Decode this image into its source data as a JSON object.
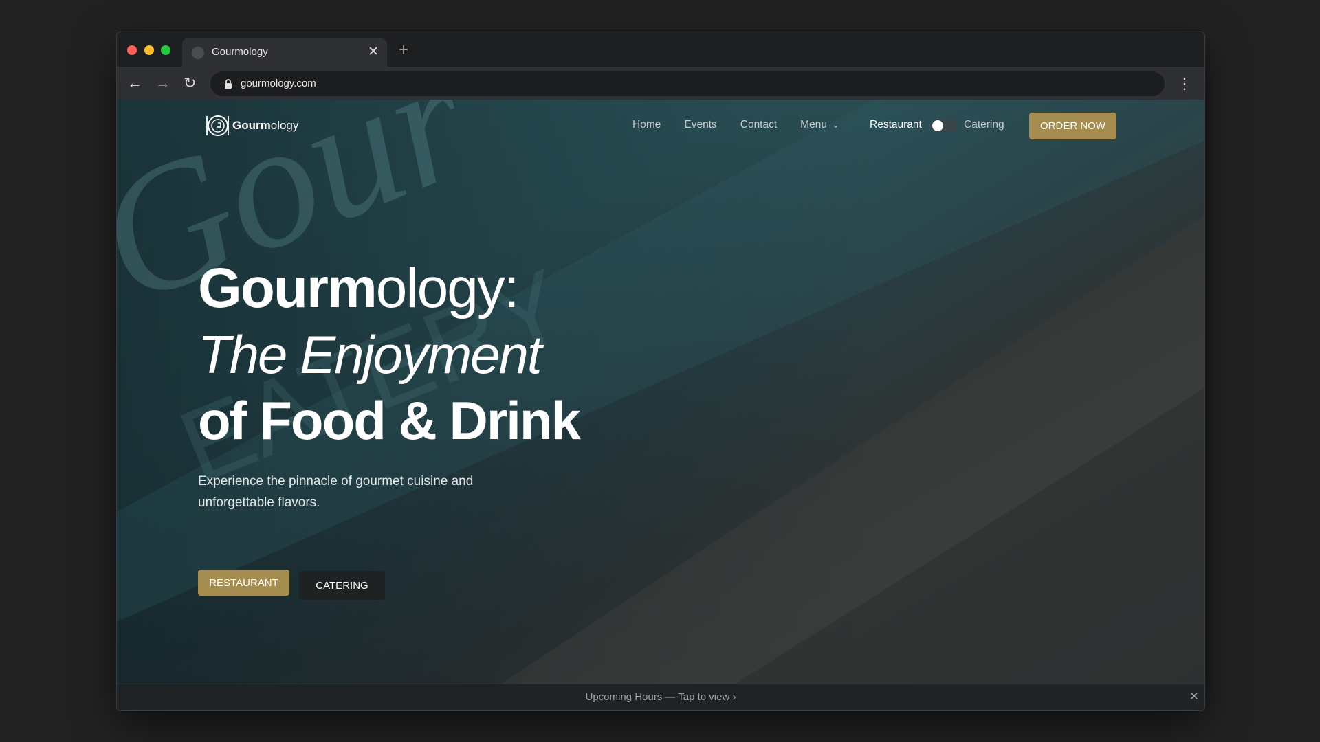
{
  "browser": {
    "tab_title": "Gourmology",
    "tab_close": "✕",
    "new_tab": "+",
    "url": "gourmology.com",
    "back": "←",
    "forward": "→",
    "reload": "↻",
    "menu": "⋮"
  },
  "site": {
    "logo_bold": "Gourm",
    "logo_light": "ology",
    "nav": {
      "home": "Home",
      "events": "Events",
      "contact": "Contact",
      "menu": "Menu",
      "menu_chevron": "⌄"
    },
    "mode_toggle": {
      "left_label": "Restaurant",
      "right_label": "Catering",
      "selected": "Restaurant"
    },
    "order_button": "ORDER NOW"
  },
  "hero": {
    "title_bold": "Gourm",
    "title_light": "ology:",
    "title_line2": "The Enjoyment",
    "title_line3": "of Food & Drink",
    "subtitle": "Experience the pinnacle of gourmet cuisine and unforgettable flavors.",
    "cta_restaurant": "RESTAURANT",
    "cta_catering": "CATERING"
  },
  "notice": {
    "text": "Upcoming Hours — Tap to view  ›",
    "close": "✕"
  },
  "colors": {
    "accent_gold": "#a48d4e",
    "hero_teal": "#2d5a60"
  }
}
